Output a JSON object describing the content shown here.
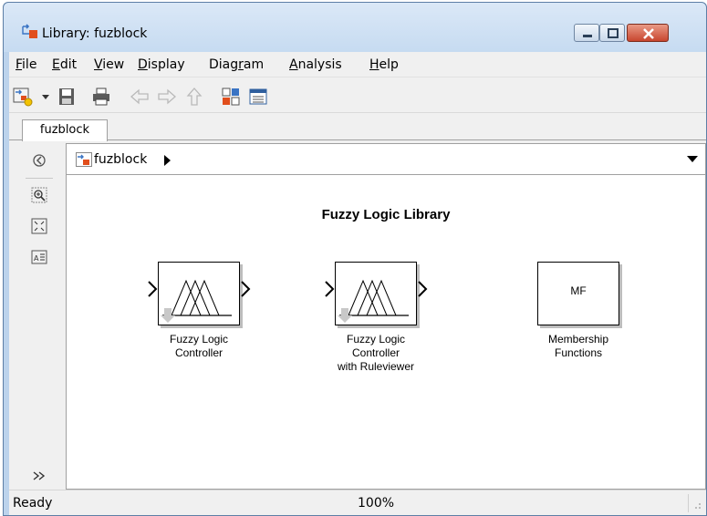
{
  "window": {
    "title": "Library: fuzblock"
  },
  "menu": [
    {
      "label": "File",
      "u": "F",
      "rest": "ile"
    },
    {
      "label": "Edit",
      "u": "E",
      "rest": "dit"
    },
    {
      "label": "View",
      "u": "V",
      "rest": "iew"
    },
    {
      "label": "Display",
      "u": "D",
      "rest": "isplay"
    },
    {
      "label": "Diagram",
      "pre": "Diag",
      "u": "r",
      "rest": "am"
    },
    {
      "label": "Analysis",
      "u": "A",
      "rest": "nalysis"
    },
    {
      "label": "Help",
      "u": "H",
      "rest": "elp"
    }
  ],
  "tab": {
    "label": "fuzblock"
  },
  "address": {
    "path": "fuzblock"
  },
  "diagram": {
    "title": "Fuzzy Logic Library",
    "blocks": [
      {
        "label_lines": [
          "Fuzzy Logic",
          "Controller"
        ]
      },
      {
        "label_lines": [
          "Fuzzy Logic",
          "Controller",
          "with Ruleviewer"
        ]
      },
      {
        "label_lines": [
          "Membership",
          "Functions"
        ],
        "text": "MF"
      }
    ]
  },
  "status": {
    "text": "Ready",
    "zoom": "100%"
  },
  "colors": {
    "accent": "#3a74c4",
    "close": "#c8462f"
  },
  "icons": {
    "toolbar": [
      "new-library-icon",
      "dropdown-arrow-icon",
      "save-icon",
      "print-icon",
      "back-icon",
      "forward-icon",
      "up-icon",
      "model-browser-icon",
      "explorer-icon"
    ],
    "sidebar": [
      "hide-browser-icon",
      "zoom-icon",
      "fit-view-icon",
      "annotation-icon",
      "more-icon"
    ]
  }
}
